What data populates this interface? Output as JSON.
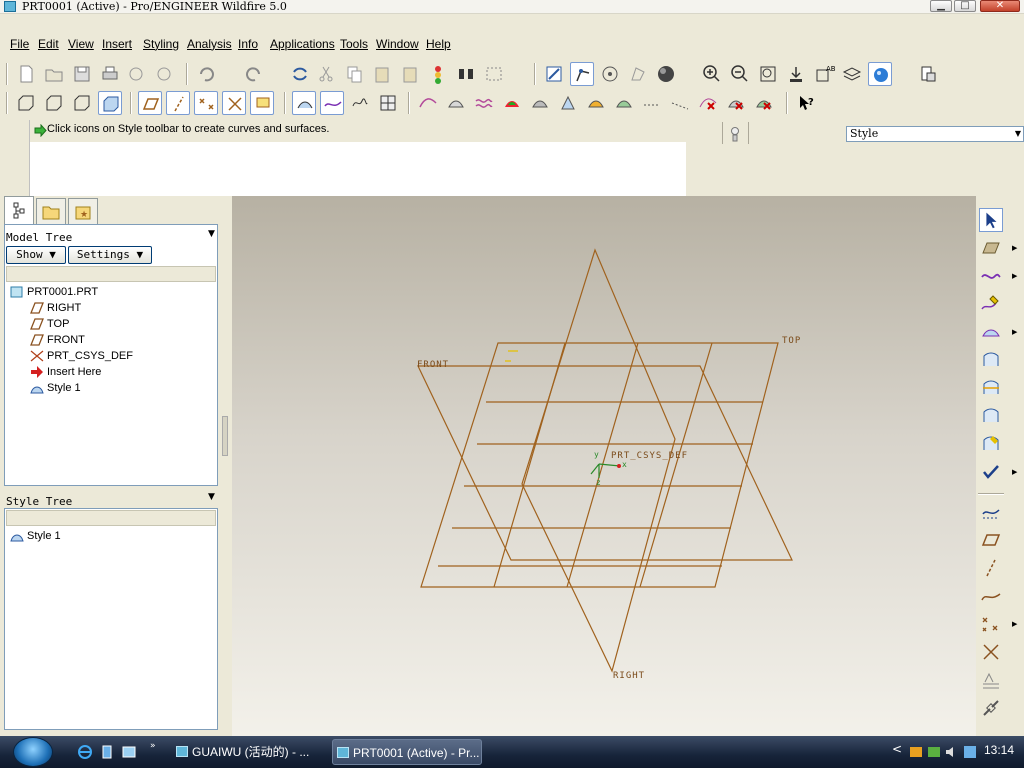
{
  "window": {
    "title": "PRT0001 (Active) - Pro/ENGINEER Wildfire 5.0",
    "min_glyph": "▁",
    "max_glyph": "□",
    "close_glyph": "✕"
  },
  "menu": [
    "File",
    "Edit",
    "View",
    "Insert",
    "Styling",
    "Analysis",
    "Info",
    "Applications",
    "Tools",
    "Window",
    "Help"
  ],
  "message": {
    "text": "Click icons on Style toolbar to create curves and surfaces."
  },
  "style_combo": {
    "value": "Style"
  },
  "left_panel": {
    "model_tree_title": "Model Tree",
    "show_button": "Show ▼",
    "settings_button": "Settings ▼",
    "model_tree_items": [
      {
        "label": "PRT0001.PRT",
        "icon": "part-icon"
      },
      {
        "label": "RIGHT",
        "icon": "datum-plane-icon"
      },
      {
        "label": "TOP",
        "icon": "datum-plane-icon"
      },
      {
        "label": "FRONT",
        "icon": "datum-plane-icon"
      },
      {
        "label": "PRT_CSYS_DEF",
        "icon": "coordinate-system-icon"
      },
      {
        "label": "Insert Here",
        "icon": "insert-arrow-icon"
      },
      {
        "label": "Style 1",
        "icon": "style-feature-icon"
      }
    ],
    "style_tree_title": "Style Tree",
    "style_tree_items": [
      {
        "label": "Style 1",
        "icon": "style-feature-icon"
      }
    ]
  },
  "graphics": {
    "labels": {
      "front": "FRONT",
      "top": "TOP",
      "right": "RIGHT",
      "csys": "PRT_CSYS_DEF"
    },
    "axis_labels": {
      "x": "x",
      "y": "y",
      "z": "z"
    },
    "datum_color": "#a0621e"
  },
  "taskbar": {
    "items": [
      {
        "label": "GUAIWU (活动的) - ...",
        "active": false
      },
      {
        "label": "PRT0001 (Active) - Pr...",
        "active": true
      }
    ],
    "clock": "13:14",
    "tray_arrow": "<"
  }
}
